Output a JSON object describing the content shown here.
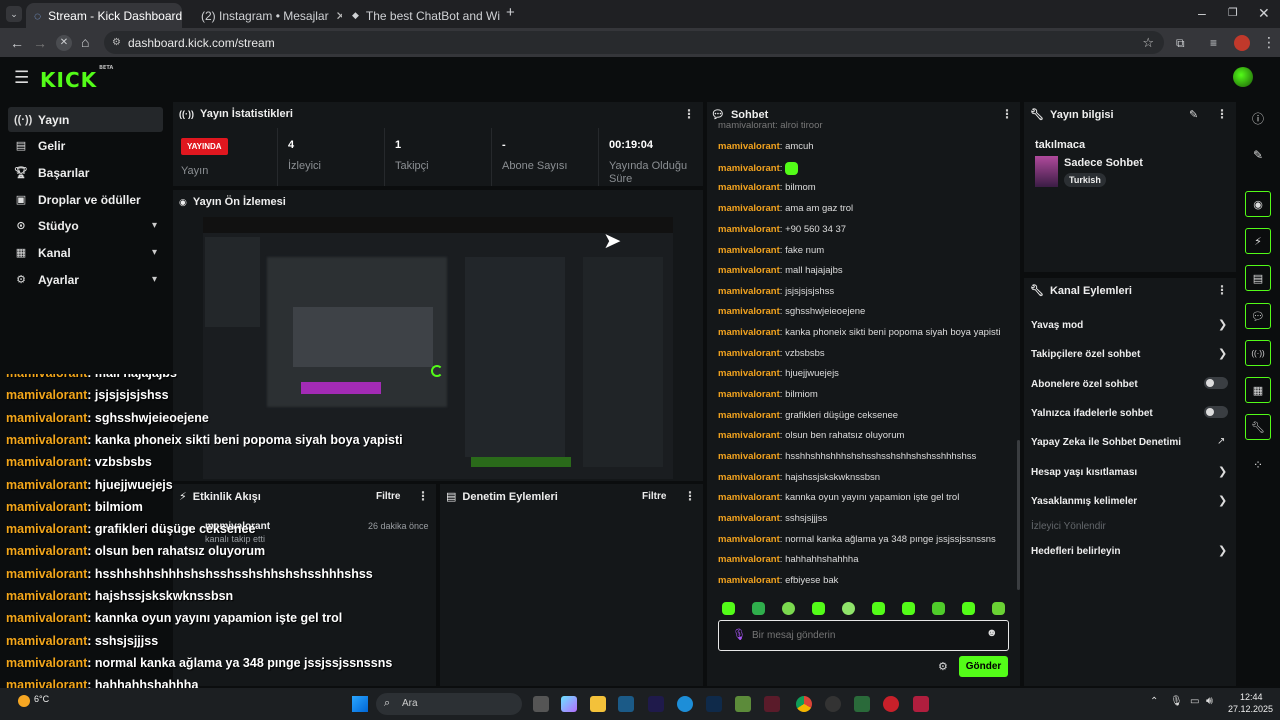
{
  "browser": {
    "tabs": [
      {
        "label": "Stream - Kick Dashboard"
      },
      {
        "label": "(2) Instagram • Mesajlar"
      },
      {
        "label": "The best ChatBot and Widgets"
      }
    ],
    "url": "dashboard.kick.com/stream"
  },
  "header": {
    "logo": "KICK",
    "beta": "BETA"
  },
  "sidebar": {
    "items": [
      {
        "label": "Yayın"
      },
      {
        "label": "Gelir"
      },
      {
        "label": "Başarılar"
      },
      {
        "label": "Droplar ve ödüller"
      },
      {
        "label": "Stüdyo"
      },
      {
        "label": "Kanal"
      },
      {
        "label": "Ayarlar"
      }
    ]
  },
  "stats": {
    "title": "Yayın İstatistikleri",
    "live_badge": "YAYINDA",
    "live_label": "Yayın",
    "viewers_value": "4",
    "viewers_label": "İzleyici",
    "followers_value": "1",
    "followers_label": "Takipçi",
    "subs_value": "-",
    "subs_label": "Abone Sayısı",
    "duration_value": "00:19:04",
    "duration_label": "Yayında Olduğu Süre"
  },
  "preview": {
    "title": "Yayın Ön İzlemesi"
  },
  "activity": {
    "title": "Etkinlik Akışı",
    "filter": "Filtre",
    "item_user": "mamivalorant",
    "item_text": "kanalı takip etti",
    "item_time": "26 dakika önce"
  },
  "modlog": {
    "title": "Denetim Eylemleri",
    "filter": "Filtre"
  },
  "chat": {
    "title": "Sohbet",
    "username": "mamivalorant",
    "top_partial": "mamivalorant: alroi tiroor",
    "messages": [
      "amcuh",
      "",
      "bilmom",
      "ama am gaz trol",
      "+90 560 34 37",
      "fake num",
      "mall hajajajbs",
      "jsjsjsjsjshss",
      "sghsshwjeieoejene",
      "kanka phoneix sikti beni popoma siyah boya yapisti",
      "vzbsbsbs",
      "hjuejjwuejejs",
      "bilmiom",
      "grafikleri düşüge ceksenee",
      "olsun ben rahatsız oluyorum",
      "hsshhshhshhhshshsshsshshhshshsshhhshss",
      "hajshssjskskwknssbsn",
      "kannka oyun yayını yapamion işte gel trol",
      "sshsjsjjjss",
      "normal kanka ağlama ya 348 pınge jssjssjssnssns",
      "hahhahhshahhha",
      "efbiyese bak"
    ],
    "input_placeholder": "Bir mesaj gönderin",
    "send": "Gönder"
  },
  "info": {
    "title": "Yayın bilgisi",
    "stream_title": "takılmaca",
    "category": "Sadece Sohbet",
    "language": "Turkish"
  },
  "channel_actions": {
    "title": "Kanal Eylemleri",
    "items": [
      "Yavaş mod",
      "Takipçilere özel sohbet",
      "Abonelere özel sohbet",
      "Yalnızca ifadelerle sohbet",
      "Yapay Zeka ile Sohbet Denetimi",
      "Hesap yaşı kısıtlaması",
      "Yasaklanmış kelimeler",
      "İzleyici Yönlendir",
      "Hedefleri belirleyin"
    ]
  },
  "overlay_chat": [
    {
      "user": "mamivalorant",
      "text": ": mall hajajajbs"
    },
    {
      "user": "mamivalorant",
      "text": ": jsjsjsjsjshss"
    },
    {
      "user": "mamivalorant",
      "text": ": sghsshwjeieoejene"
    },
    {
      "user": "mamivalorant",
      "text": ": kanka phoneix sikti beni popoma siyah boya yapisti"
    },
    {
      "user": "mamivalorant",
      "text": ": vzbsbsbs"
    },
    {
      "user": "mamivalorant",
      "text": ": hjuejjwuejejs"
    },
    {
      "user": "mamivalorant",
      "text": ": bilmiom"
    },
    {
      "user": "mamivalorant",
      "text": ": grafikleri düşüge ceksenee"
    },
    {
      "user": "mamivalorant",
      "text": ": olsun ben rahatsız oluyorum"
    },
    {
      "user": "mamivalorant",
      "text": ": hsshhshhshhhshshsshsshshhshshsshhhshss"
    },
    {
      "user": "mamivalorant",
      "text": ": hajshssjskskwknssbsn"
    },
    {
      "user": "mamivalorant",
      "text": ": kannka oyun yayını yapamion işte gel trol"
    },
    {
      "user": "mamivalorant",
      "text": ": sshsjsjjjss"
    },
    {
      "user": "mamivalorant",
      "text": ": normal kanka ağlama ya 348 pınge jssjssjssnssns"
    },
    {
      "user": "mamivalorant",
      "text": ": hahhahhshahhha"
    },
    {
      "user": "mamivalorant",
      "text": ": efbiyese bak"
    }
  ],
  "taskbar": {
    "weather": "6°C",
    "search": "Ara",
    "time": "12:44",
    "date": "27.12.2025"
  },
  "colors": {
    "accent": "#53fc18",
    "live": "#e0171f",
    "username": "#f2a31f"
  }
}
